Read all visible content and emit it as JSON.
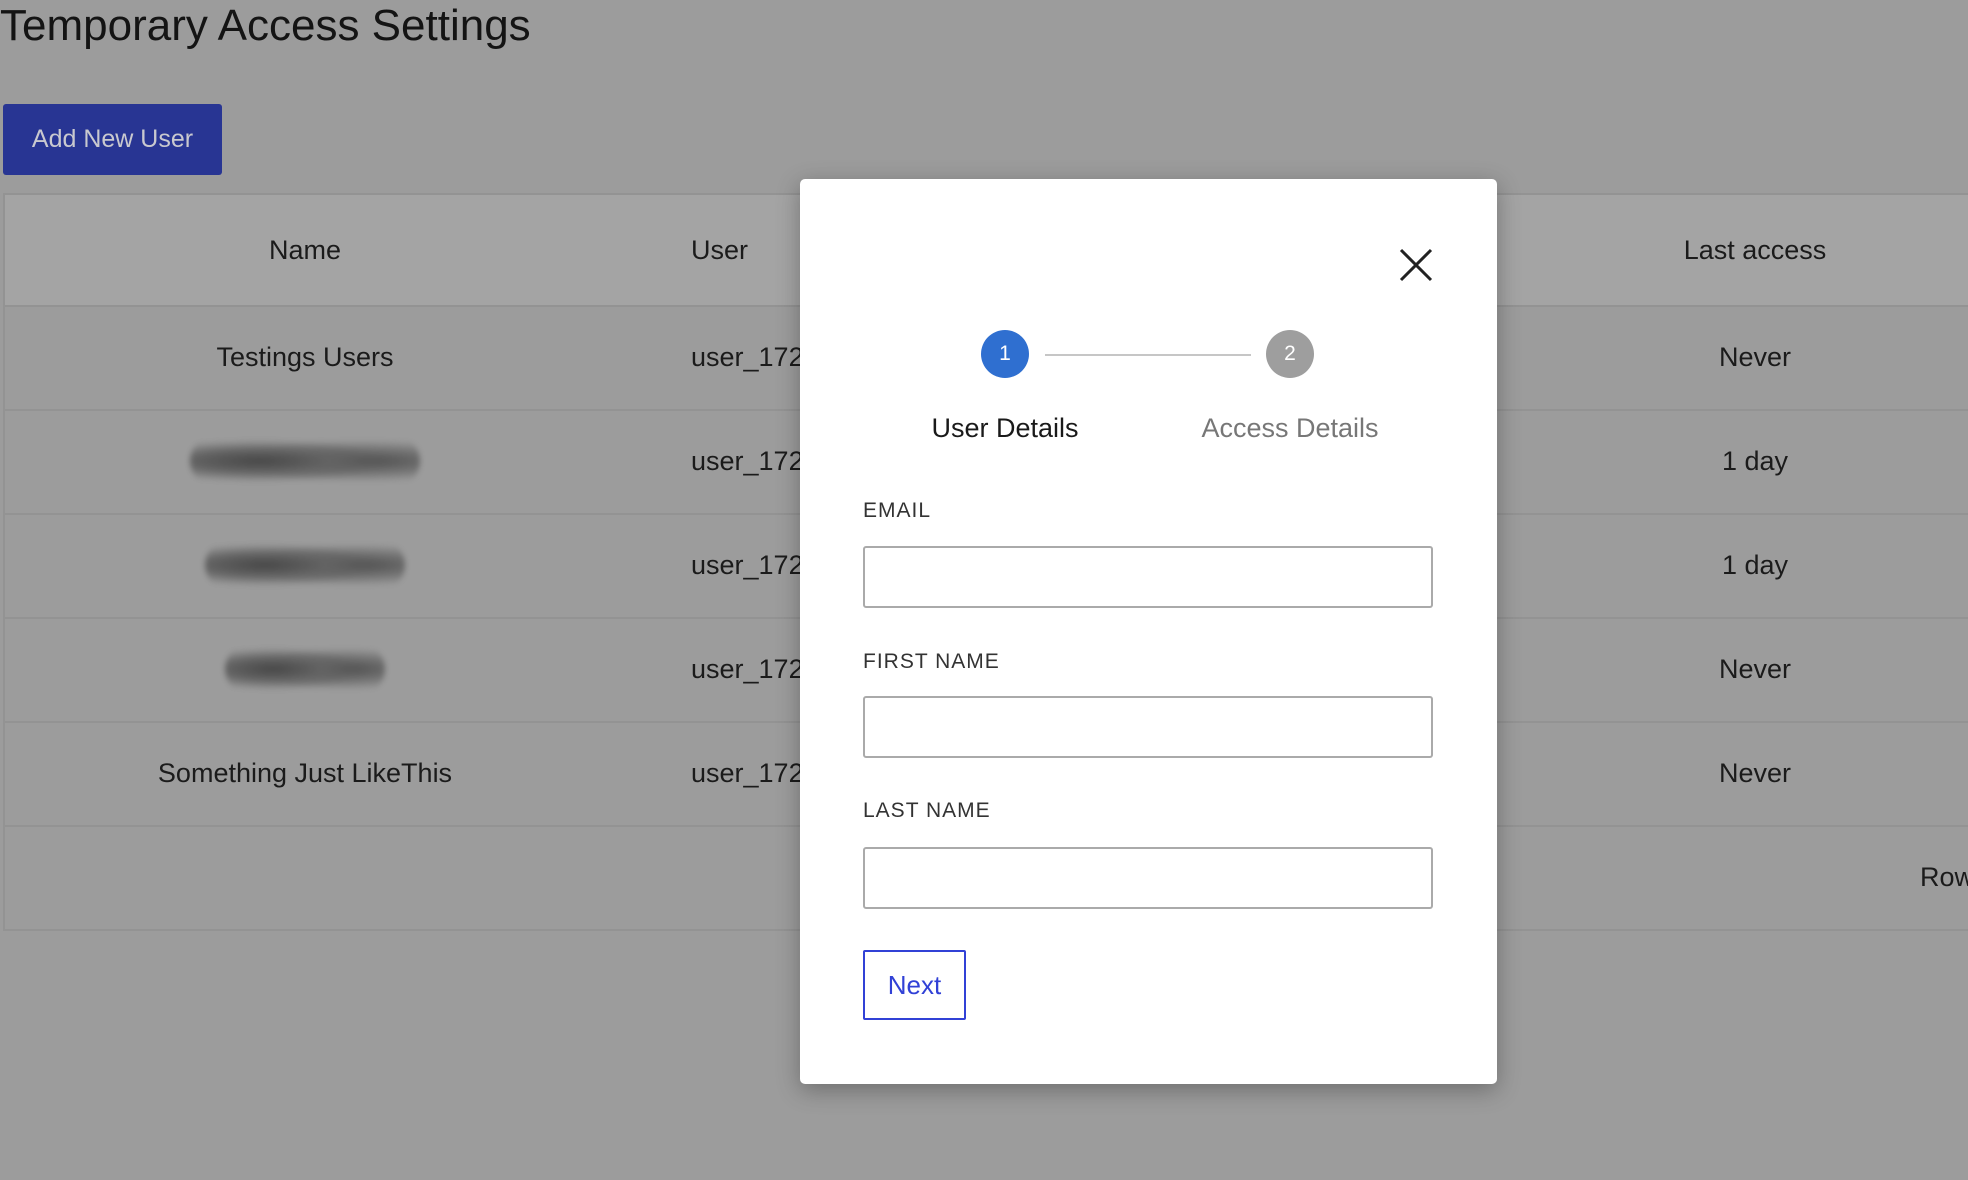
{
  "page": {
    "title": "Temporary Access Settings",
    "add_button": "Add New User"
  },
  "table": {
    "headers": {
      "name": "Name",
      "user": "User",
      "last_access": "Last access"
    },
    "rows": [
      {
        "name": "Testings Users",
        "user": "user_172",
        "last_access": "Never",
        "name_redacted": false
      },
      {
        "name": "",
        "user": "user_172",
        "last_access": "1 day",
        "name_redacted": true
      },
      {
        "name": "",
        "user": "user_172",
        "last_access": "1 day",
        "name_redacted": true
      },
      {
        "name": "",
        "user": "user_172",
        "last_access": "Never",
        "name_redacted": true
      },
      {
        "name": "Something Just LikeThis",
        "user": "user_172",
        "last_access": "Never",
        "name_redacted": false
      }
    ],
    "footer_label": "Row"
  },
  "modal": {
    "steps": [
      {
        "number": "1",
        "label": "User Details",
        "active": true
      },
      {
        "number": "2",
        "label": "Access Details",
        "active": false
      }
    ],
    "fields": {
      "email": {
        "label": "EMAIL",
        "value": ""
      },
      "first_name": {
        "label": "FIRST NAME",
        "value": ""
      },
      "last_name": {
        "label": "LAST NAME",
        "value": ""
      }
    },
    "next_button": "Next"
  },
  "colors": {
    "primary": "#283593",
    "step_active": "#2f6fd0",
    "step_inactive": "#9e9e9e",
    "next": "#3141d6"
  }
}
